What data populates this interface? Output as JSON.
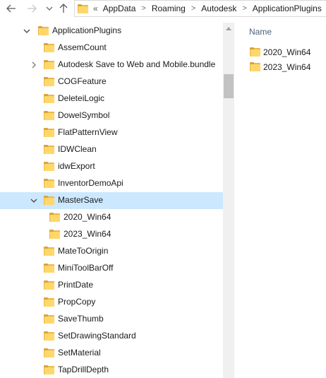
{
  "nav": {
    "back_icon": "back-arrow-icon",
    "forward_icon": "forward-arrow-icon",
    "recent_icon": "chevron-down-icon",
    "up_icon": "up-arrow-icon"
  },
  "address": {
    "overflow": "«",
    "crumbs": [
      "AppData",
      "Roaming",
      "Autodesk",
      "ApplicationPlugins"
    ],
    "separator": ">"
  },
  "tree": {
    "root": "ApplicationPlugins",
    "items": [
      {
        "label": "AssemCount"
      },
      {
        "label": "Autodesk Save to Web and Mobile.bundle",
        "expandable": true
      },
      {
        "label": "COGFeature"
      },
      {
        "label": "DeleteiLogic"
      },
      {
        "label": "DowelSymbol"
      },
      {
        "label": "FlatPatternView"
      },
      {
        "label": "IDWClean"
      },
      {
        "label": "idwExport"
      },
      {
        "label": "InventorDemoApi"
      },
      {
        "label": "MasterSave",
        "expanded": true,
        "selected": true
      },
      {
        "label": "2020_Win64",
        "child": true
      },
      {
        "label": "2023_Win64",
        "child": true
      },
      {
        "label": "MateToOrigin"
      },
      {
        "label": "MiniToolBarOff"
      },
      {
        "label": "PrintDate"
      },
      {
        "label": "PropCopy"
      },
      {
        "label": "SaveThumb"
      },
      {
        "label": "SetDrawingStandard"
      },
      {
        "label": "SetMaterial"
      },
      {
        "label": "TapDrillDepth"
      }
    ]
  },
  "content": {
    "column_header": "Name",
    "items": [
      "2020_Win64",
      "2023_Win64"
    ]
  },
  "colors": {
    "selection": "#cce8ff",
    "folder": "#ffd76b",
    "header_text": "#4c607a"
  }
}
